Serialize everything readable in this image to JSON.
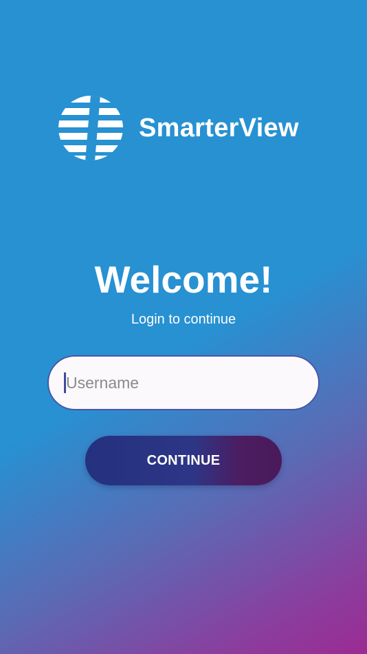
{
  "brand": {
    "name": "SmarterView",
    "logo_icon": "striped-globe-icon"
  },
  "welcome": {
    "title": "Welcome!",
    "subtitle": "Login to continue"
  },
  "form": {
    "username": {
      "value": "",
      "placeholder": "Username"
    },
    "continue_label": "CONTINUE"
  },
  "colors": {
    "background_top": "#2791d2",
    "background_bottom": "#9b2b93",
    "button_start": "#24317f",
    "button_end": "#4a1a5a",
    "input_border": "#4a55a6",
    "input_background": "#fbf9fb"
  }
}
